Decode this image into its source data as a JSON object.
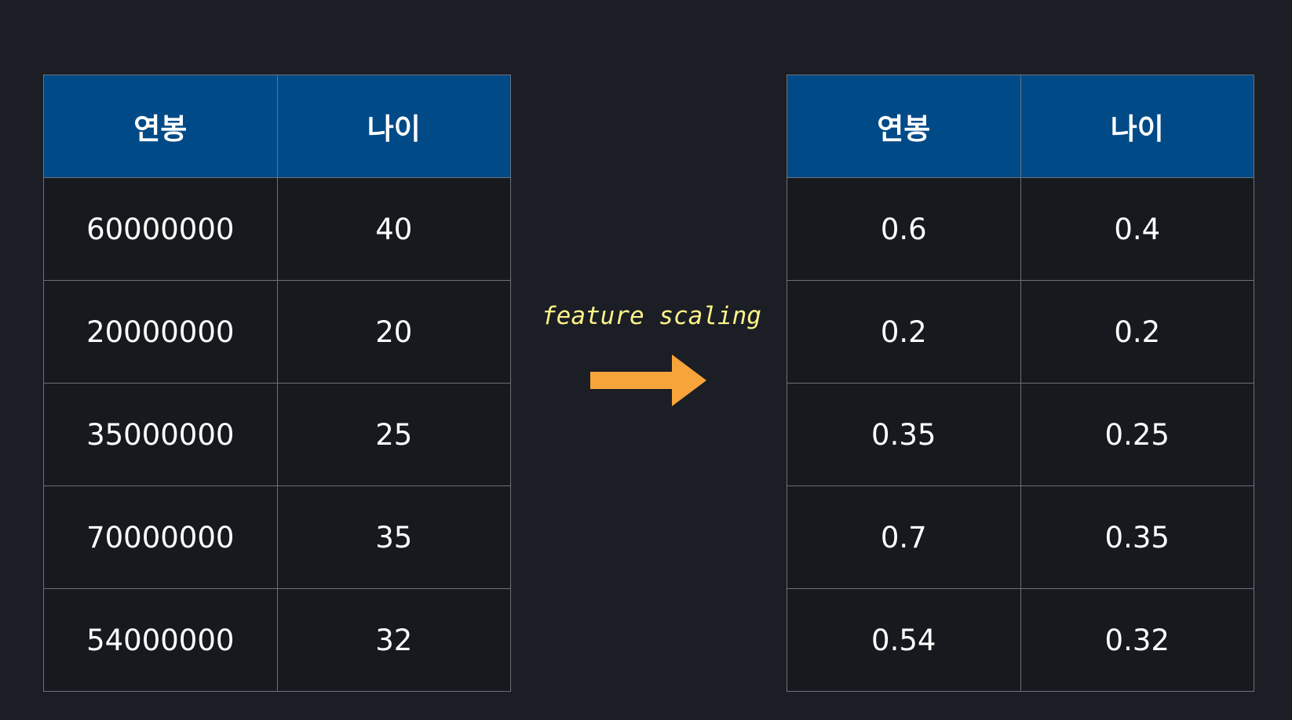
{
  "left_table": {
    "headers": [
      "연봉",
      "나이"
    ],
    "rows": [
      [
        "60000000",
        "40"
      ],
      [
        "20000000",
        "20"
      ],
      [
        "35000000",
        "25"
      ],
      [
        "70000000",
        "35"
      ],
      [
        "54000000",
        "32"
      ]
    ]
  },
  "transform": {
    "label": "feature scaling",
    "arrow_icon": "arrow-right-icon",
    "label_color": "#fff38a",
    "arrow_color": "#f7a43b"
  },
  "right_table": {
    "headers": [
      "연봉",
      "나이"
    ],
    "rows": [
      [
        "0.6",
        "0.4"
      ],
      [
        "0.2",
        "0.2"
      ],
      [
        "0.35",
        "0.25"
      ],
      [
        "0.7",
        "0.35"
      ],
      [
        "0.54",
        "0.32"
      ]
    ]
  },
  "colors": {
    "background": "#1b1e24",
    "header_fill": "#004a87",
    "cell_fill": "#16191e",
    "border": "#6c7079"
  }
}
